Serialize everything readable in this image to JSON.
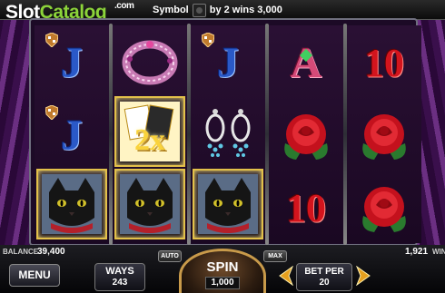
{
  "logo": {
    "brand_part1": "Slot",
    "brand_part2": "Catalog",
    "suffix": ".com"
  },
  "banner": {
    "prefix": "Symbol",
    "text": "by 2 wins 3,000"
  },
  "reels": [
    [
      "J",
      "bracelet",
      "cat"
    ],
    [
      "J",
      "2x wild",
      "cat"
    ],
    [
      "J",
      "earrings",
      "cat"
    ],
    [
      "A",
      "rose",
      "10"
    ],
    [
      "10",
      "rose",
      "rose"
    ]
  ],
  "symbols": {
    "j": "J",
    "a": "A",
    "ten": "10",
    "wild": "2x"
  },
  "stats": {
    "balance_label": "BALANCE",
    "balance_value": "39,400",
    "win_value": "1,921",
    "win_label": "WIN"
  },
  "controls": {
    "menu": "MENU",
    "ways_label": "WAYS",
    "ways_value": "243",
    "auto": "AUTO",
    "max": "MAX",
    "spin": "SPIN",
    "spin_value": "1,000",
    "betper_label": "BET PER",
    "betper_value": "20"
  },
  "colors": {
    "win_highlight": "#e3c14a",
    "brand_green": "#8cd43a",
    "rose": "#c4111d",
    "spin_ring": "#c89a4a"
  }
}
